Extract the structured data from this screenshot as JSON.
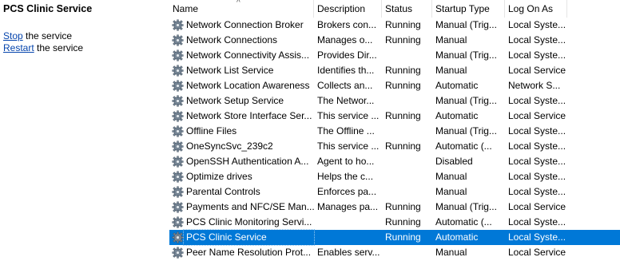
{
  "left_pane": {
    "title": "PCS Clinic Service",
    "stop_link": "Stop",
    "stop_rest": " the service",
    "restart_link": "Restart",
    "restart_rest": " the service"
  },
  "columns": {
    "name": "Name",
    "description": "Description",
    "status": "Status",
    "startup_type": "Startup Type",
    "log_on_as": "Log On As",
    "sort_indicator": "^"
  },
  "services": [
    {
      "name": "Network Connection Broker",
      "description": "Brokers con...",
      "status": "Running",
      "startup": "Manual (Trig...",
      "logon": "Local Syste..."
    },
    {
      "name": "Network Connections",
      "description": "Manages o...",
      "status": "Running",
      "startup": "Manual",
      "logon": "Local Syste..."
    },
    {
      "name": "Network Connectivity Assis...",
      "description": "Provides Dir...",
      "status": "",
      "startup": "Manual (Trig...",
      "logon": "Local Syste..."
    },
    {
      "name": "Network List Service",
      "description": "Identifies th...",
      "status": "Running",
      "startup": "Manual",
      "logon": "Local Service"
    },
    {
      "name": "Network Location Awareness",
      "description": "Collects an...",
      "status": "Running",
      "startup": "Automatic",
      "logon": "Network S..."
    },
    {
      "name": "Network Setup Service",
      "description": "The Networ...",
      "status": "",
      "startup": "Manual (Trig...",
      "logon": "Local Syste..."
    },
    {
      "name": "Network Store Interface Ser...",
      "description": "This service ...",
      "status": "Running",
      "startup": "Automatic",
      "logon": "Local Service"
    },
    {
      "name": "Offline Files",
      "description": "The Offline ...",
      "status": "",
      "startup": "Manual (Trig...",
      "logon": "Local Syste..."
    },
    {
      "name": "OneSyncSvc_239c2",
      "description": "This service ...",
      "status": "Running",
      "startup": "Automatic (...",
      "logon": "Local Syste..."
    },
    {
      "name": "OpenSSH Authentication A...",
      "description": "Agent to ho...",
      "status": "",
      "startup": "Disabled",
      "logon": "Local Syste..."
    },
    {
      "name": "Optimize drives",
      "description": "Helps the c...",
      "status": "",
      "startup": "Manual",
      "logon": "Local Syste..."
    },
    {
      "name": "Parental Controls",
      "description": "Enforces pa...",
      "status": "",
      "startup": "Manual",
      "logon": "Local Syste..."
    },
    {
      "name": "Payments and NFC/SE Man...",
      "description": "Manages pa...",
      "status": "Running",
      "startup": "Manual (Trig...",
      "logon": "Local Service"
    },
    {
      "name": "PCS Clinic Monitoring Servi...",
      "description": "",
      "status": "Running",
      "startup": "Automatic (...",
      "logon": "Local Syste..."
    },
    {
      "name": "PCS Clinic Service",
      "description": "",
      "status": "Running",
      "startup": "Automatic",
      "logon": "Local Syste...",
      "selected": true
    },
    {
      "name": "Peer Name Resolution Prot...",
      "description": "Enables serv...",
      "status": "",
      "startup": "Manual",
      "logon": "Local Service"
    }
  ],
  "colors": {
    "selection": "#0078d7",
    "link": "#0645ad"
  },
  "icons": {
    "service": "gear-icon"
  }
}
